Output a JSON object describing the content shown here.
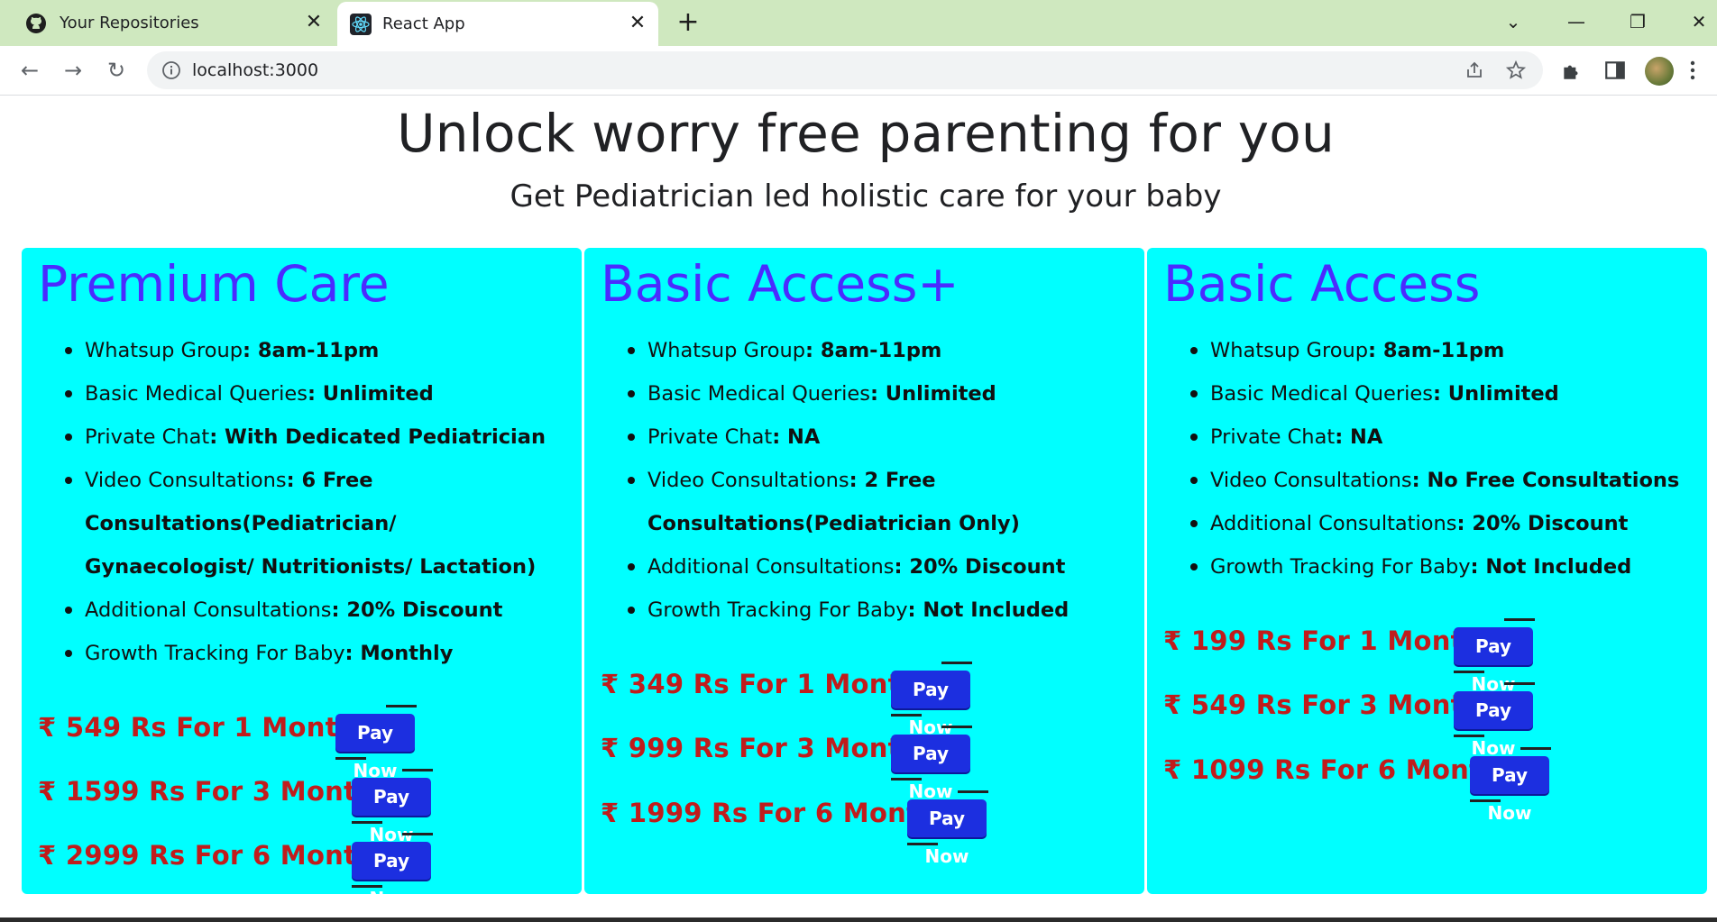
{
  "browser": {
    "tabs": [
      {
        "title": "Your Repositories",
        "icon": "github-icon",
        "active": false
      },
      {
        "title": "React App",
        "icon": "react-icon",
        "active": true
      }
    ],
    "url": "localhost:3000",
    "new_tab_label": "+",
    "window_controls": {
      "list": "⌄",
      "minimize": "—",
      "restore": "❐",
      "close": "✕"
    }
  },
  "page": {
    "headline": "Unlock worry free parenting for you",
    "subheadline": "Get Pediatrician led holistic care for your baby"
  },
  "plans": [
    {
      "name": "Premium Care",
      "features": [
        {
          "label": "Whatsup Group",
          "value": "8am-11pm"
        },
        {
          "label": "Basic Medical Queries",
          "value": "Unlimited"
        },
        {
          "label": "Private Chat",
          "value": "With Dedicated Pediatrician"
        },
        {
          "label": "Video Consultations",
          "value": "6 Free Consultations(Pediatrician/ Gynaecologist/ Nutritionists/ Lactation)"
        },
        {
          "label": "Additional Consultations",
          "value": "20% Discount"
        },
        {
          "label": "Growth Tracking For Baby",
          "value": "Monthly"
        }
      ],
      "prices": [
        {
          "text": "₹ 549 Rs For 1 Month",
          "button": "Pay Now"
        },
        {
          "text": "₹ 1599 Rs For 3 Month",
          "button": "Pay Now"
        },
        {
          "text": "₹ 2999 Rs For 6 Month",
          "button": "Pay Now"
        }
      ]
    },
    {
      "name": "Basic Access+",
      "features": [
        {
          "label": "Whatsup Group",
          "value": "8am-11pm"
        },
        {
          "label": "Basic Medical Queries",
          "value": "Unlimited"
        },
        {
          "label": "Private Chat",
          "value": "NA"
        },
        {
          "label": "Video Consultations",
          "value": "2 Free Consultations(Pediatrician Only)"
        },
        {
          "label": "Additional Consultations",
          "value": "20% Discount"
        },
        {
          "label": "Growth Tracking For Baby",
          "value": "Not Included"
        }
      ],
      "prices": [
        {
          "text": "₹ 349 Rs For 1 Month",
          "button": "Pay Now"
        },
        {
          "text": "₹ 999 Rs For 3 Month",
          "button": "Pay Now"
        },
        {
          "text": "₹ 1999 Rs For 6 Month",
          "button": "Pay Now"
        }
      ]
    },
    {
      "name": "Basic Access",
      "features": [
        {
          "label": "Whatsup Group",
          "value": "8am-11pm"
        },
        {
          "label": "Basic Medical Queries",
          "value": "Unlimited"
        },
        {
          "label": "Private Chat",
          "value": "NA"
        },
        {
          "label": "Video Consultations",
          "value": "No Free Consultations"
        },
        {
          "label": "Additional Consultations",
          "value": "20% Discount"
        },
        {
          "label": "Growth Tracking For Baby",
          "value": "Not Included"
        }
      ],
      "prices": [
        {
          "text": "₹ 199 Rs For 1 Month",
          "button": "Pay Now"
        },
        {
          "text": "₹ 549 Rs For 3 Month",
          "button": "Pay Now"
        },
        {
          "text": "₹ 1099 Rs For 6 Month",
          "button": "Pay Now"
        }
      ]
    }
  ],
  "colors": {
    "card_background": "#00ffff",
    "plan_title": "#4b2bff",
    "price_text": "#c01c1c",
    "pay_button": "#1c2fe0",
    "tabstrip": "#cfe8bf"
  }
}
